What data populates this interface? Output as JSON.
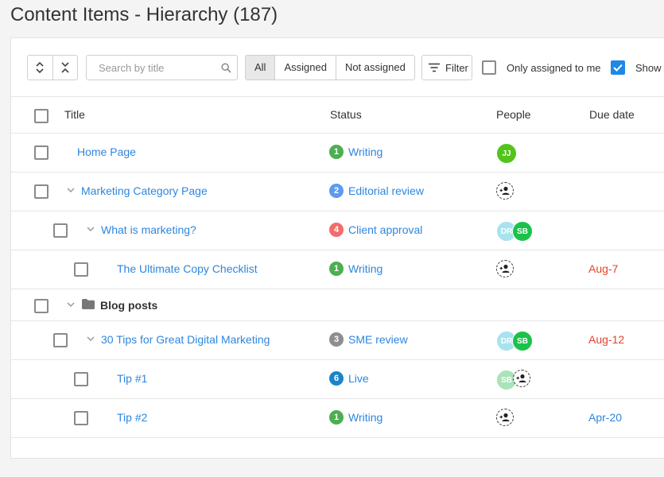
{
  "page": {
    "title": "Content Items - Hierarchy (187)"
  },
  "toolbar": {
    "search_placeholder": "Search by title",
    "segments": [
      "All",
      "Assigned",
      "Not assigned"
    ],
    "active_segment": "All",
    "filter_label": "Filter",
    "only_assigned_label": "Only assigned to me",
    "only_assigned_checked": false,
    "show_label": "Show",
    "show_checked": true
  },
  "table": {
    "headers": {
      "title": "Title",
      "status": "Status",
      "people": "People",
      "due": "Due date"
    },
    "rows": [
      {
        "title": "Home Page",
        "status_num": "1",
        "status": "Writing",
        "status_color": "#4caf50",
        "people": [
          {
            "initials": "JJ",
            "color": "#52c41a"
          }
        ],
        "due": ""
      },
      {
        "title": "Marketing Category Page",
        "status_num": "2",
        "status": "Editorial review",
        "status_color": "#5b9cf0",
        "people": [],
        "due": ""
      },
      {
        "title": "What is marketing?",
        "status_num": "4",
        "status": "Client approval",
        "status_color": "#f26c6c",
        "people": [
          {
            "initials": "DR",
            "color": "#a7e3ee"
          },
          {
            "initials": "SB",
            "color": "#1bc24a"
          }
        ],
        "due": ""
      },
      {
        "title": "The Ultimate Copy Checklist",
        "status_num": "1",
        "status": "Writing",
        "status_color": "#4caf50",
        "people": [],
        "due": "Aug-7",
        "due_color": "#e0442a"
      },
      {
        "title": "Blog posts"
      },
      {
        "title": "30 Tips for Great Digital Marketing",
        "status_num": "3",
        "status": "SME review",
        "status_color": "#8e8e8e",
        "people": [
          {
            "initials": "DR",
            "color": "#a7e3ee"
          },
          {
            "initials": "SB",
            "color": "#1bc24a"
          }
        ],
        "due": "Aug-12",
        "due_color": "#e0442a"
      },
      {
        "title": "Tip #1",
        "status_num": "6",
        "status": "Live",
        "status_color": "#1b84c9",
        "people": [
          {
            "initials": "SB",
            "color": "#a9e3b7"
          }
        ],
        "due": ""
      },
      {
        "title": "Tip #2",
        "status_num": "1",
        "status": "Writing",
        "status_color": "#4caf50",
        "people": [],
        "due": "Apr-20",
        "due_color": "#2e86de"
      }
    ]
  }
}
